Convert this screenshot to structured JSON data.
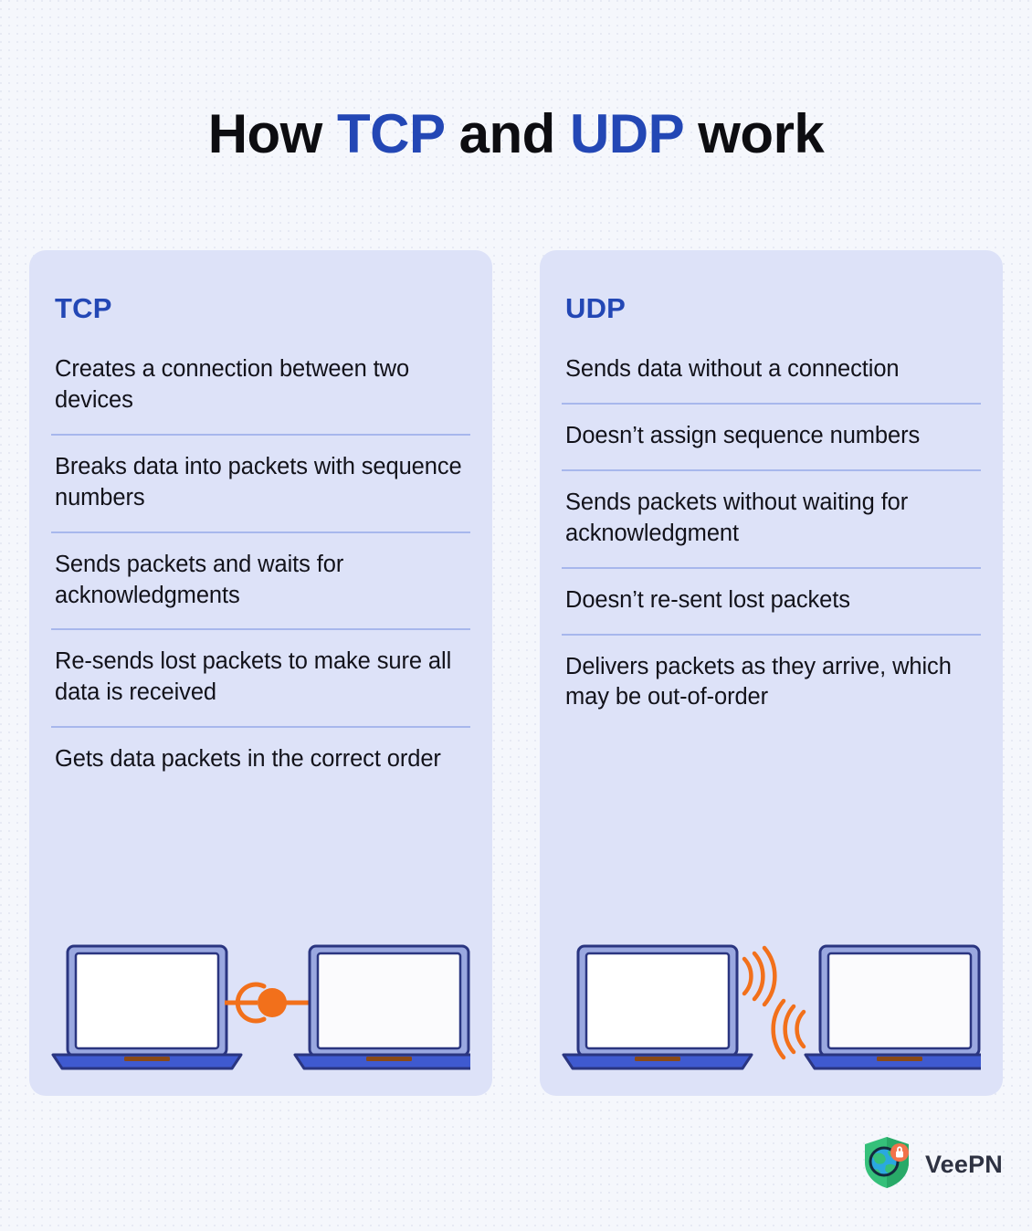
{
  "title": {
    "part1": "How ",
    "accent1": "TCP",
    "part2": " and ",
    "accent2": "UDP",
    "part3": " work"
  },
  "colors": {
    "accent_blue": "#2347b5",
    "panel_bg": "#dde2f8",
    "page_bg": "#f5f7fc",
    "divider": "#a7b7ec",
    "orange": "#f2701b",
    "laptop_bezel": "#9aa8e0",
    "laptop_outline": "#2a3580",
    "laptop_base": "#3f5ad0",
    "trackpad": "#8a4a18",
    "logo_shield": "#35c07a",
    "logo_text": "#2e3242"
  },
  "panels": [
    {
      "id": "tcp",
      "heading": "TCP",
      "features": [
        "Creates a connection between two devices",
        "Breaks data into packets with sequence numbers",
        "Sends packets and waits for acknowledgments",
        "Re-sends lost packets to make sure all data is received",
        "Gets data packets in the correct order"
      ],
      "illustration": "two-laptops-wired-connection"
    },
    {
      "id": "udp",
      "heading": "UDP",
      "features": [
        "Sends data without a connection",
        "Doesn’t assign sequence numbers",
        "Sends packets without waiting for acknowledgment",
        "Doesn’t re-sent lost packets",
        "Delivers packets as they arrive, which may be out-of-order"
      ],
      "illustration": "two-laptops-wireless-signals"
    }
  ],
  "footer": {
    "brand": "VeePN",
    "logo_icon": "shield-globe-lock-icon"
  }
}
